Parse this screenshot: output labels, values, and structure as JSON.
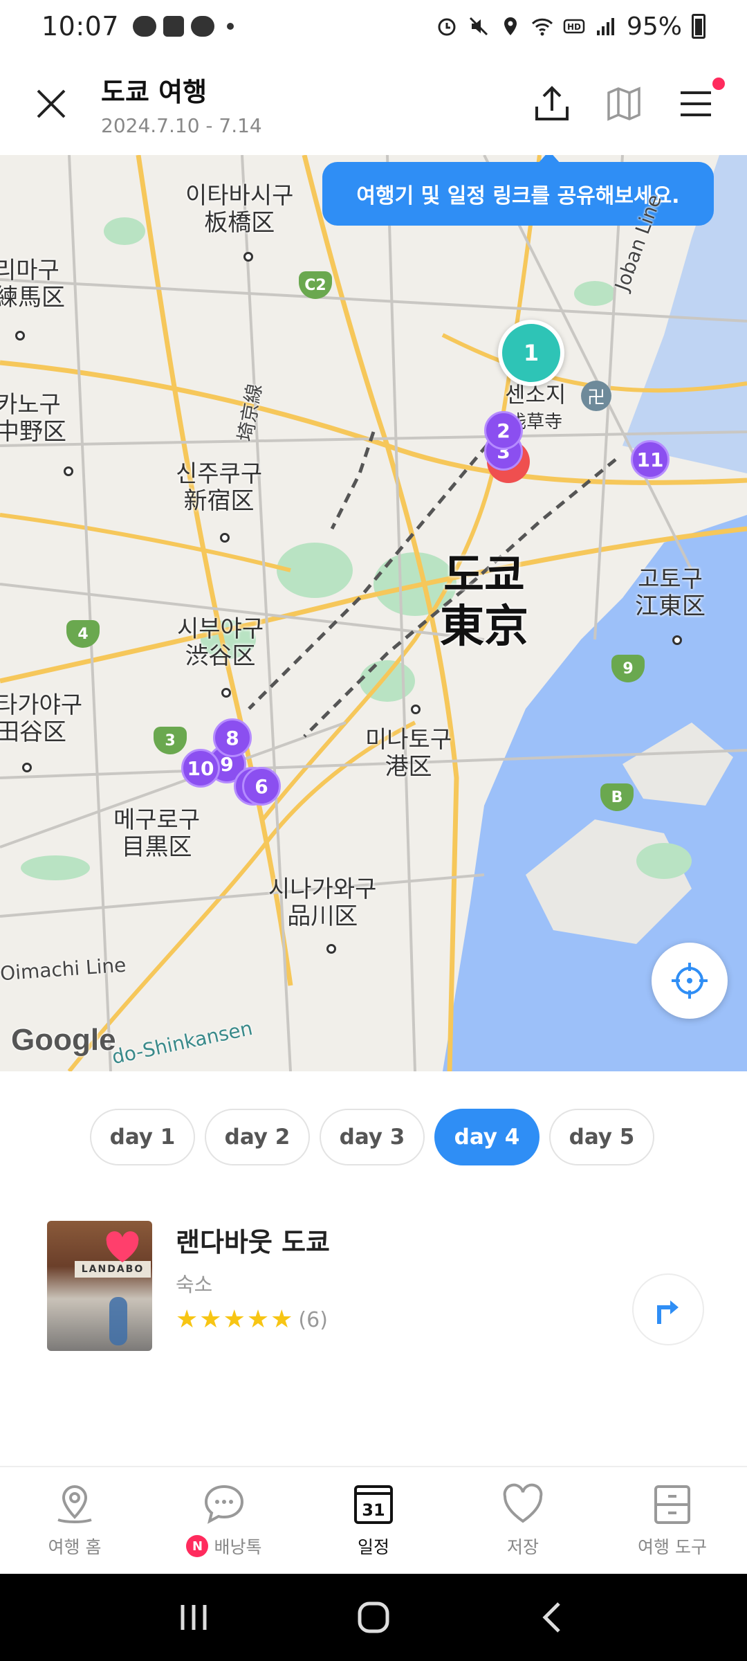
{
  "status_bar": {
    "time": "10:07",
    "battery": "95%",
    "icons": [
      "kakaotalk-icon",
      "cafe-icon",
      "chat-icon",
      "alarm-icon",
      "mute-icon",
      "location-icon",
      "wifi-icon",
      "hd-icon",
      "signal-icon",
      "battery-icon"
    ]
  },
  "header": {
    "title": "도쿄 여행",
    "dates": "2024.7.10 - 7.14",
    "actions": [
      "share-icon",
      "map-icon",
      "menu-icon"
    ]
  },
  "map": {
    "tooltip": "여행기 및 일정 링크를 공유해보세요.",
    "labels": [
      {
        "ko": "이타바시구",
        "ja": "板橋区"
      },
      {
        "ko": "리마구",
        "ja": "練馬区"
      },
      {
        "ko": "카노구",
        "ja": "中野区"
      },
      {
        "ko": "신주쿠구",
        "ja": "新宿区"
      },
      {
        "ko": "시부야구",
        "ja": "渋谷区"
      },
      {
        "ko": "타가야구",
        "ja": "田谷区"
      },
      {
        "ko": "메구로구",
        "ja": "目黒区"
      },
      {
        "ko": "시나가와구",
        "ja": "品川区"
      },
      {
        "ko": "미나토구",
        "ja": "港区"
      },
      {
        "ko": "고토구",
        "ja": "江東区"
      },
      {
        "ko": "도쿄",
        "ja": "東京"
      },
      {
        "ko": "센소지",
        "ja": "浅草寺"
      }
    ],
    "line_labels": [
      "Joban Line",
      "Oimachi Line",
      "do-Shinkansen",
      "埼京線"
    ],
    "route_badges": [
      "C2",
      "4",
      "3",
      "9",
      "B"
    ],
    "pins": {
      "teal": "1",
      "purple": [
        "2",
        "3",
        "8",
        "9",
        "10",
        "6",
        "11"
      ]
    },
    "attribution": "Google",
    "colors": {
      "pin_purple": "#8b4ff0",
      "pin_teal": "#2ec4b6",
      "accent": "#2f8ef5"
    }
  },
  "day_tabs": [
    {
      "label": "day 1",
      "active": false
    },
    {
      "label": "day 2",
      "active": false
    },
    {
      "label": "day 3",
      "active": false
    },
    {
      "label": "day 4",
      "active": true
    },
    {
      "label": "day 5",
      "active": false
    }
  ],
  "place": {
    "name": "랜다바웃 도쿄",
    "category": "숙소",
    "rating_stars": 5,
    "rating_count": "(6)",
    "thumb_sign": "LANDABO"
  },
  "bottom_nav": [
    {
      "label": "여행 홈",
      "icon": "location-pin-icon",
      "active": false
    },
    {
      "label": "배낭톡",
      "icon": "chat-bubble-icon",
      "badge": "N",
      "active": false
    },
    {
      "label": "일정",
      "icon": "calendar-icon",
      "calendar_day": "31",
      "active": true
    },
    {
      "label": "저장",
      "icon": "heart-icon",
      "active": false
    },
    {
      "label": "여행 도구",
      "icon": "toolbox-icon",
      "active": false
    }
  ]
}
